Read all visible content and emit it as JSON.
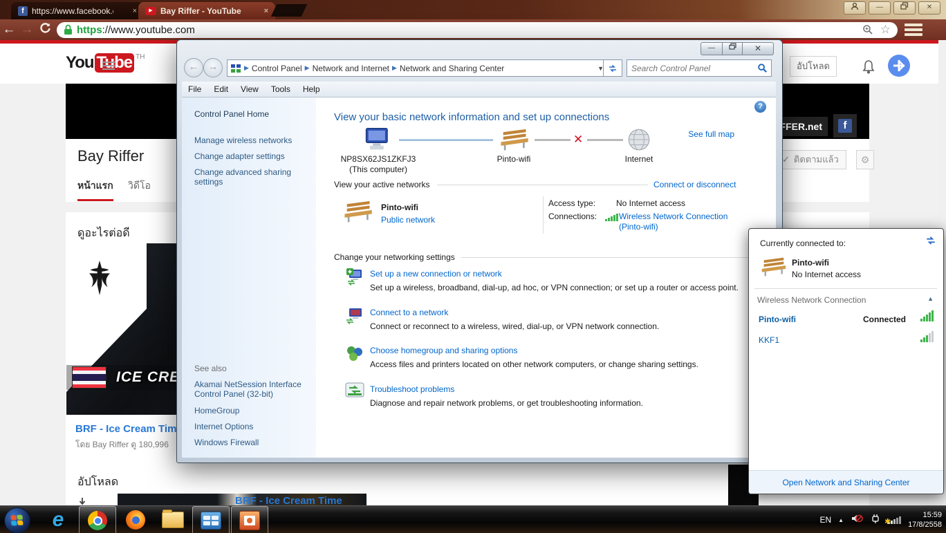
{
  "colors": {
    "youtube_red": "#cc181e",
    "link_blue": "#0066cc",
    "browser_wood_brown": "#6f2f20",
    "signal_green": "#3cb54a",
    "facebook_blue": "#3b5998"
  },
  "browser": {
    "tab1": {
      "title": "https://www.facebook.con",
      "icon": "facebook"
    },
    "tab2": {
      "title": "Bay Riffer - YouTube",
      "icon": "youtube"
    },
    "close_glyph": "×",
    "https_prefix": "https",
    "address_rest": "://www.youtube.com"
  },
  "youtube": {
    "logo_you": "You",
    "logo_tube": "Tube",
    "logo_region": "TH",
    "upload_button": "อัปโหลด",
    "banner_site": "RIFFER.net",
    "channel_title": "Bay Riffer",
    "subscribe_check": "✓",
    "subscribe_label": "ติดตามแล้ว",
    "gear_glyph": "⚙",
    "tab_home": "หน้าแรก",
    "tab_videos": "วิดีโอ",
    "watch_next_heading": "ดูอะไรต่อดี",
    "thumb_text": "ICE CREAM",
    "video_title": "BRF - Ice Cream Time",
    "video_meta": "โดย Bay Riffer   ดู 180,996",
    "uploads_heading": "อัปโหลด",
    "upload_item_title": "BRF - Ice Cream Time"
  },
  "control_panel": {
    "breadcrumb1": "Control Panel",
    "breadcrumb2": "Network and Internet",
    "breadcrumb3": "Network and Sharing Center",
    "search_placeholder": "Search Control Panel",
    "menu_file": "File",
    "menu_edit": "Edit",
    "menu_view": "View",
    "menu_tools": "Tools",
    "menu_help": "Help",
    "sidebar_home": "Control Panel Home",
    "sidebar_link1": "Manage wireless networks",
    "sidebar_link2": "Change adapter settings",
    "sidebar_link3": "Change advanced sharing settings",
    "see_also": "See also",
    "see_also_link1": "Akamai NetSession Interface Control Panel (32-bit)",
    "see_also_link2": "HomeGroup",
    "see_also_link3": "Internet Options",
    "see_also_link4": "Windows Firewall",
    "help_glyph": "?",
    "heading": "View your basic network information and set up connections",
    "map_computer_name": "NP8SX62JS1ZKFJ3",
    "map_computer_sub": "(This computer)",
    "map_network": "Pinto-wifi",
    "map_internet": "Internet",
    "see_full_map": "See full map",
    "active_networks_label": "View your active networks",
    "connect_disconnect": "Connect or disconnect",
    "network_name": "Pinto-wifi",
    "network_type": "Public network",
    "access_type_label": "Access type:",
    "access_type_value": "No Internet access",
    "connections_label": "Connections:",
    "connections_value": "Wireless Network Connection",
    "connections_value2": "(Pinto-wifi)",
    "change_settings_label": "Change your networking settings",
    "task1_title": "Set up a new connection or network",
    "task1_desc": "Set up a wireless, broadband, dial-up, ad hoc, or VPN connection; or set up a router or access point.",
    "task2_title": "Connect to a network",
    "task2_desc": "Connect or reconnect to a wireless, wired, dial-up, or VPN network connection.",
    "task3_title": "Choose homegroup and sharing options",
    "task3_desc": "Access files and printers located on other network computers, or change sharing settings.",
    "task4_title": "Troubleshoot problems",
    "task4_desc": "Diagnose and repair network problems, or get troubleshooting information."
  },
  "wifi_popup": {
    "header": "Currently connected to:",
    "network_name": "Pinto-wifi",
    "network_status": "No Internet access",
    "section": "Wireless Network Connection",
    "net1_name": "Pinto-wifi",
    "net1_status": "Connected",
    "net2_name": "KKF1",
    "footer_link": "Open Network and Sharing Center"
  },
  "taskbar": {
    "lang": "EN",
    "time": "15:59",
    "date": "17/8/2558"
  }
}
